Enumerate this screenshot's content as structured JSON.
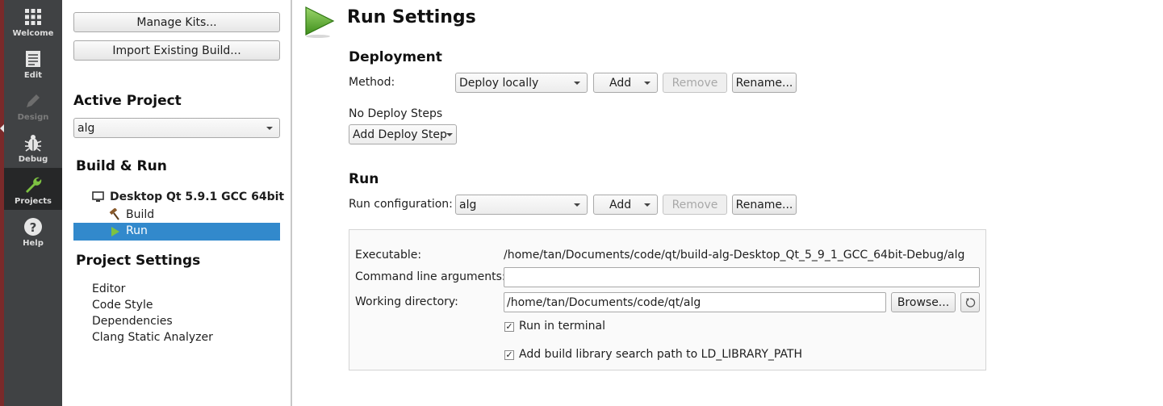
{
  "modebar": {
    "items": [
      {
        "label": "Welcome",
        "icon": "grid-icon"
      },
      {
        "label": "Edit",
        "icon": "document-icon"
      },
      {
        "label": "Design",
        "icon": "pencil-icon"
      },
      {
        "label": "Debug",
        "icon": "bug-icon"
      },
      {
        "label": "Projects",
        "icon": "wrench-icon"
      },
      {
        "label": "Help",
        "icon": "question-icon"
      }
    ],
    "active": "Projects"
  },
  "left": {
    "manage_kits": "Manage Kits...",
    "import_build": "Import Existing Build...",
    "active_project_heading": "Active Project",
    "active_project": "alg",
    "build_run_heading": "Build & Run",
    "kit": "Desktop Qt 5.9.1 GCC 64bit",
    "build": "Build",
    "run": "Run",
    "project_settings_heading": "Project Settings",
    "settings": [
      "Editor",
      "Code Style",
      "Dependencies",
      "Clang Static Analyzer"
    ]
  },
  "main": {
    "title": "Run Settings",
    "deployment": {
      "heading": "Deployment",
      "method_label": "Method:",
      "method_value": "Deploy locally",
      "add": "Add",
      "remove": "Remove",
      "rename": "Rename...",
      "no_steps": "No Deploy Steps",
      "add_step": "Add Deploy Step"
    },
    "run": {
      "heading": "Run",
      "config_label": "Run configuration:",
      "config_value": "alg",
      "add": "Add",
      "remove": "Remove",
      "rename": "Rename...",
      "executable_label": "Executable:",
      "executable_value": "/home/tan/Documents/code/qt/build-alg-Desktop_Qt_5_9_1_GCC_64bit-Debug/alg",
      "args_label": "Command line arguments:",
      "args_value": "",
      "workdir_label": "Working directory:",
      "workdir_value": "/home/tan/Documents/code/qt/alg",
      "browse": "Browse...",
      "run_in_terminal": "Run in terminal",
      "run_in_terminal_checked": true,
      "ld_path": "Add build library search path to LD_LIBRARY_PATH",
      "ld_path_checked": true
    }
  },
  "colors": {
    "modebar": "#404244",
    "modebar_active": "#262728",
    "selection": "#3289cc",
    "run_green": "#5aa92c"
  }
}
